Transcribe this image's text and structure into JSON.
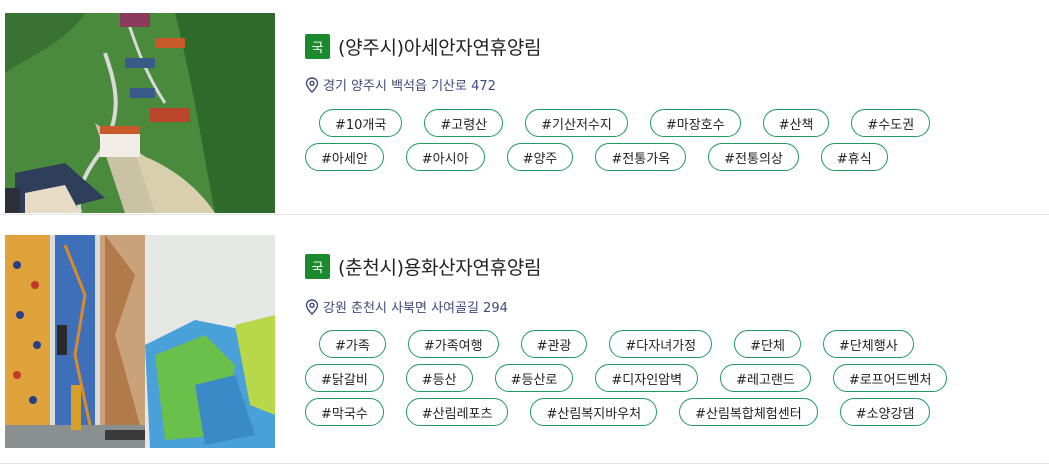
{
  "items": [
    {
      "badge": "국",
      "title": "(양주시)아세안자연휴양림",
      "address": "경기 양주시 백석읍 기산로 472",
      "tags": [
        "#10개국",
        "#고령산",
        "#기산저수지",
        "#마장호수",
        "#산책",
        "#수도권",
        "#아세안",
        "#아시아",
        "#양주",
        "#전통가옥",
        "#전통의상",
        "#휴식"
      ]
    },
    {
      "badge": "국",
      "title": "(춘천시)용화산자연휴양림",
      "address": "강원 춘천시 사북면 사여골길 294",
      "tags": [
        "#가족",
        "#가족여행",
        "#관광",
        "#다자녀가정",
        "#단체",
        "#단체행사",
        "#닭갈비",
        "#등산",
        "#등산로",
        "#디자인암벽",
        "#레고랜드",
        "#로프어드벤처",
        "#막국수",
        "#산림레포츠",
        "#산림복지바우처",
        "#산림복합체험센터",
        "#소양강댐"
      ]
    }
  ],
  "colors": {
    "badge": "#1a8a2c",
    "tag_border": "#1f9a5f",
    "address": "#3d4a7a"
  }
}
